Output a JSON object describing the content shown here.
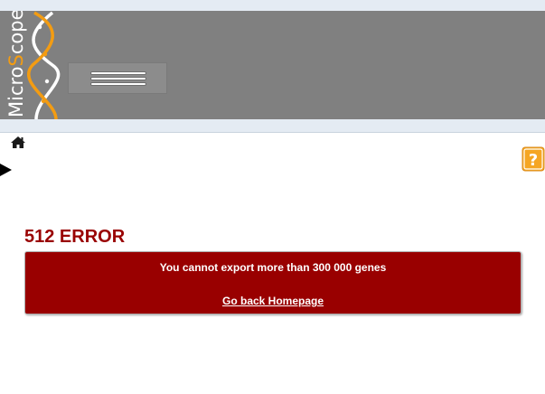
{
  "logo": {
    "name": "MicroScope",
    "icon": "dna-helix-logo",
    "accent": "#f39c12"
  },
  "header": {
    "menu_icon": "hamburger-menu-icon",
    "background": "#808080"
  },
  "nav": {
    "home_icon": "home-icon",
    "help_icon": "help-question-icon",
    "expand_icon": "play-arrow-icon"
  },
  "error": {
    "title": "512 ERROR",
    "message": "You cannot export more than 300 000 genes",
    "link": "Go back Homepage",
    "color": "#990000"
  }
}
